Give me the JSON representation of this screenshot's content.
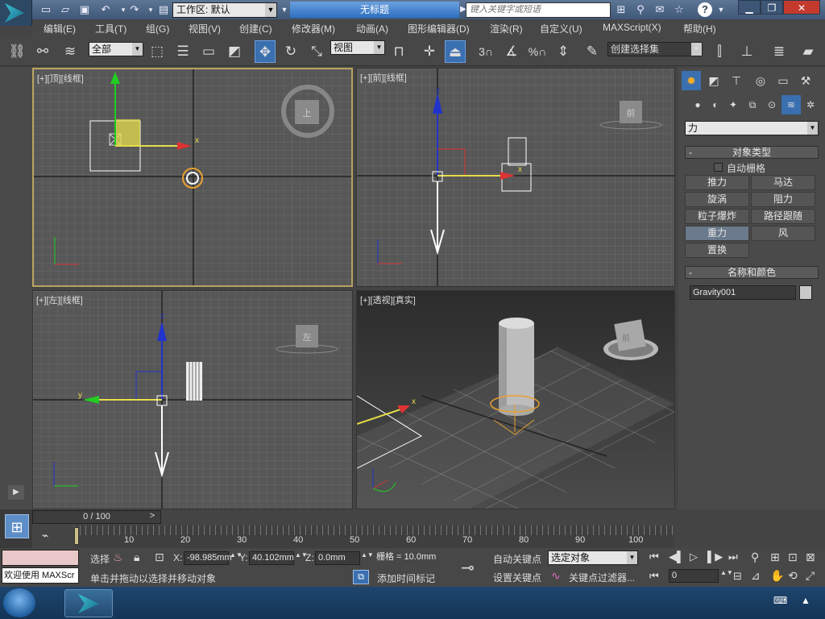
{
  "app": {
    "workspace_label": "工作区: 默认",
    "window_title": "无标题",
    "search_placeholder": "键入关键字或短语",
    "help_label": "?"
  },
  "menus": [
    "编辑(E)",
    "工具(T)",
    "组(G)",
    "视图(V)",
    "创建(C)",
    "修改器(M)",
    "动画(A)",
    "图形编辑器(D)",
    "渲染(R)",
    "自定义(U)",
    "MAXScript(X)",
    "帮助(H)"
  ],
  "toolbar": {
    "selection_filter": "全部",
    "reference_coord": "视图",
    "named_selection": "创建选择集",
    "snap_3": "3",
    "snap_percent": "%"
  },
  "viewports": {
    "top": {
      "label": "[+][顶][线框]",
      "cube_face": "上"
    },
    "front": {
      "label": "[+][前][线框]",
      "cube_face": "前"
    },
    "left": {
      "label": "[+][左][线框]",
      "cube_face": "左"
    },
    "perspective": {
      "label": "[+][透视][真实]",
      "cube_face": "前"
    },
    "axis": {
      "x": "x",
      "y": "y",
      "z": "z"
    }
  },
  "command_panel": {
    "category_dropdown": "力",
    "object_type_header": "对象类型",
    "auto_grid_label": "自动栅格",
    "buttons": [
      "推力",
      "马达",
      "旋涡",
      "阻力",
      "粒子爆炸",
      "路径跟随",
      "重力",
      "风",
      "置换"
    ],
    "name_color_header": "名称和颜色",
    "object_name": "Gravity001",
    "object_color": "#c8c8c8",
    "rollout_collapse": "-"
  },
  "timeline": {
    "slider_label": "0 / 100",
    "ticks": [
      "10",
      "20",
      "30",
      "40",
      "50",
      "60",
      "70",
      "80",
      "90",
      "100"
    ],
    "left_arrow": "<",
    "right_arrow": ">"
  },
  "status": {
    "maxscript_label": "欢迎使用 MAXScr",
    "selected_label": "选择",
    "x_label": "X:",
    "x_value": "-98.985mm",
    "y_label": "Y:",
    "y_value": "40.102mm",
    "z_label": "Z:",
    "z_value": "0.0mm",
    "grid_label": "栅格 = 10.0mm",
    "prompt": "单击并拖动以选择并移动对象",
    "add_time_tag": "添加时间标记",
    "auto_key": "自动关键点",
    "set_key": "设置关键点",
    "key_mode": "选定对象",
    "key_filters": "关键点过滤器...",
    "current_frame": "0"
  },
  "colors": {
    "viewport_bg": "#575757",
    "active_border": "#b8a35e",
    "axis_x": "#d33",
    "axis_y": "#2c2",
    "axis_z": "#23c",
    "gravity_gizmo": "#e8a030"
  }
}
